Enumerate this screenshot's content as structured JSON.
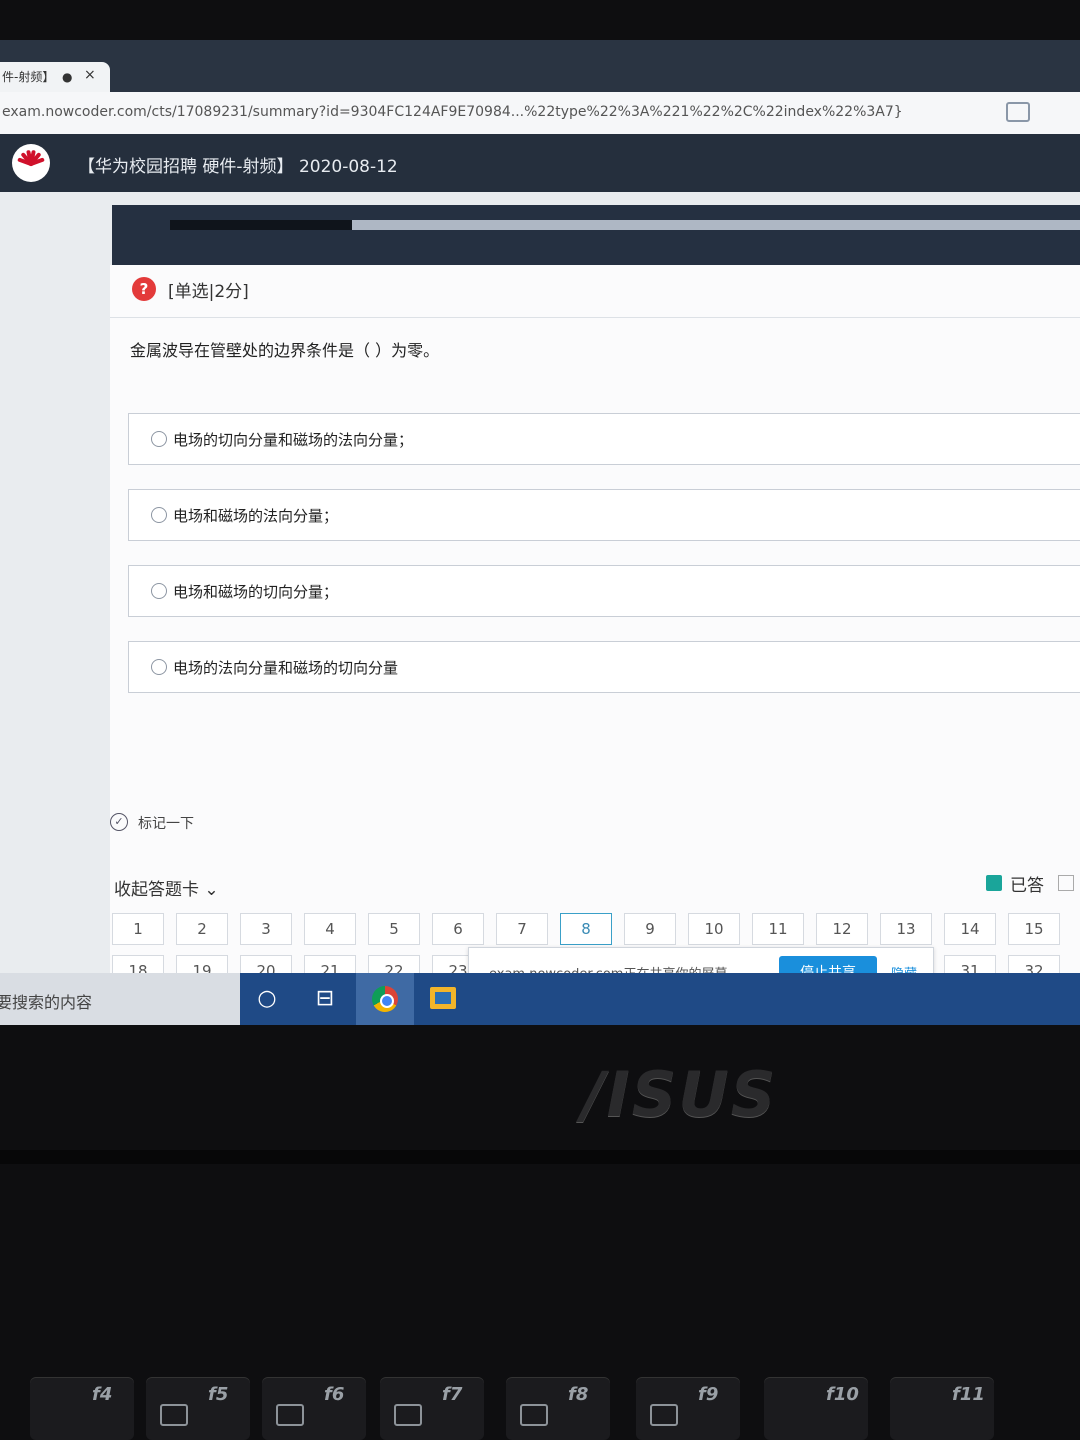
{
  "browser": {
    "tab_title": "件-射频】",
    "tab_dot": "●",
    "tab_close": "×",
    "url": "exam.nowcoder.com/cts/17089231/summary?id=9304FC124AF9E70984...%22type%22%3A%221%22%2C%22index%22%3A7}"
  },
  "header": {
    "title": "【华为校园招聘 硬件-射频】 2020-08-12"
  },
  "exam": {
    "progress_fraction": 0.2,
    "question": {
      "icon_text": "?",
      "type_label": "[单选|2分]",
      "text": "金属波导在管壁处的边界条件是（ ）为零。",
      "options": [
        {
          "label": "电场的切向分量和磁场的法向分量；"
        },
        {
          "label": "电场和磁场的法向分量；"
        },
        {
          "label": "电场和磁场的切向分量；"
        },
        {
          "label": "电场的法向分量和磁场的切向分量"
        }
      ]
    },
    "mark_label": "标记一下",
    "answer_card": {
      "collapse_label": "收起答题卡",
      "legend_answered": "已答",
      "row1": [
        "1",
        "2",
        "3",
        "4",
        "5",
        "6",
        "7",
        "8",
        "9",
        "10",
        "11",
        "12",
        "13",
        "14",
        "15"
      ],
      "row2": [
        "18",
        "19",
        "20",
        "21",
        "22",
        "23",
        "",
        "",
        "",
        "",
        "",
        "",
        "",
        "31",
        "32"
      ],
      "current": "8"
    }
  },
  "share_notice": {
    "text": "exam.nowcoder.com正在共享你的屏幕。",
    "stop_label": "停止共享",
    "hide_label": "隐藏"
  },
  "taskbar": {
    "search_text": "要搜索的内容"
  },
  "laptop": {
    "brand": "/ISUS",
    "keys": [
      "f4",
      "f5",
      "f6",
      "f7",
      "f8",
      "f9",
      "f10",
      "f11"
    ]
  }
}
